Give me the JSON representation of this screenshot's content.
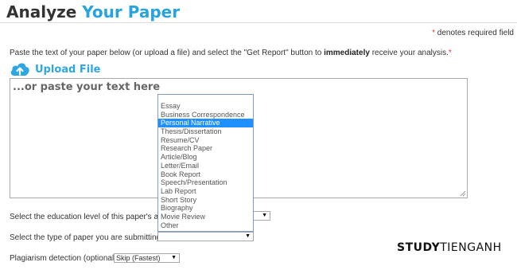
{
  "header": {
    "title_part1": "Analyze",
    "title_part2": "Your Paper"
  },
  "required_note": {
    "asterisk": "*",
    "text": " denotes required field"
  },
  "instructions": {
    "before": "Paste the text of your paper below (or upload a file) and select the \"Get Report\" button to ",
    "bold": "immediately",
    "after": " receive your analysis.",
    "asterisk": "*"
  },
  "upload": {
    "label": "Upload File",
    "icon": "cloud-upload-icon",
    "color": "#2ea6e3"
  },
  "paper_text": {
    "placeholder": "...or paste your text here"
  },
  "education": {
    "label": "Select the education level of this paper's auth",
    "value": ""
  },
  "paper_type": {
    "label": "Select the type of paper you are submitting",
    "asterisk": "*",
    "value": "",
    "options": [
      "Essay",
      "Business Correspondence",
      "Personal Narrative",
      "Thesis/Dissertation",
      "Resume/CV",
      "Research Paper",
      "Article/Blog",
      "Letter/Email",
      "Book Report",
      "Speech/Presentation",
      "Lab Report",
      "Short Story",
      "Biography",
      "Movie Review",
      "Other"
    ],
    "highlighted": "Personal Narrative"
  },
  "plagiarism": {
    "label": "Plagiarism detection (optional):",
    "value": "Skip (Fastest)"
  },
  "watermark": {
    "part1": "STUDY",
    "part2": "TIENGANH"
  },
  "colors": {
    "accent": "#29a3e0",
    "required": "#e0383e",
    "highlight": "#1e90ff"
  }
}
